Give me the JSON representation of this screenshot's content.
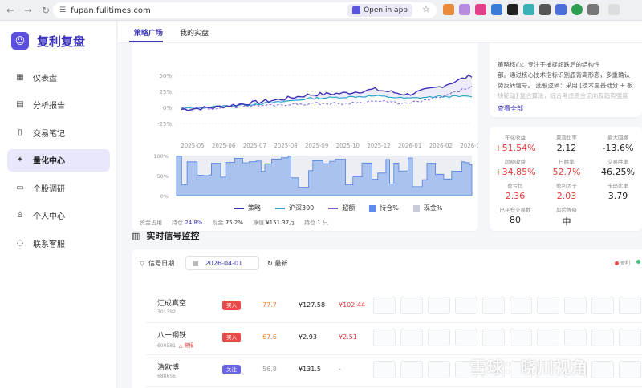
{
  "browser": {
    "url": "fupan.fulitimes.com",
    "open_in_app": "Open in app"
  },
  "sidebar": {
    "app_name": "复利复盘",
    "items": [
      {
        "label": "仪表盘",
        "icon": "grid-icon"
      },
      {
        "label": "分析报告",
        "icon": "document-icon"
      },
      {
        "label": "交易笔记",
        "icon": "notebook-icon"
      },
      {
        "label": "量化中心",
        "icon": "sparkle-icon",
        "active": true
      },
      {
        "label": "个股调研",
        "icon": "file-icon"
      },
      {
        "label": "个人中心",
        "icon": "user-icon"
      },
      {
        "label": "联系客服",
        "icon": "chat-icon"
      }
    ]
  },
  "tabs": {
    "strategy": "策略广场",
    "mine": "我的实盘"
  },
  "info": {
    "line1": "策略核心：专注于捕捉超跌后的结构性",
    "line2": "部。通过核心技术指标识别底背离形态，多重确认",
    "line3": "势反转信号。 选股逻辑：采用 [技术面基础分 + 板",
    "line4": "块轮动] 复合算法，综合考虑资金流向及趋势强度",
    "view_all": "查看全部"
  },
  "metrics": [
    {
      "label": "年化收益",
      "value": "+51.54%",
      "red": true
    },
    {
      "label": "夏普比率",
      "value": "2.12"
    },
    {
      "label": "最大回撤",
      "value": "-13.6%"
    },
    {
      "label": "超额收益",
      "value": "+34.85%",
      "red": true
    },
    {
      "label": "日胜率",
      "value": "52.7%",
      "red": true
    },
    {
      "label": "交易胜率",
      "value": "46.25%"
    },
    {
      "label": "盈亏比",
      "value": "2.36",
      "red": true
    },
    {
      "label": "盈利因子",
      "value": "2.03",
      "red": true
    },
    {
      "label": "卡玛比率",
      "value": "3.79"
    },
    {
      "label": "已平仓交易数",
      "value": "80"
    },
    {
      "label": "风险等级",
      "value": "中"
    }
  ],
  "chart_data": {
    "type": "line",
    "x": [
      "2025-05",
      "2025-06",
      "2025-07",
      "2025-08",
      "2025-09",
      "2025-10",
      "2025-12",
      "2026-01",
      "2026-02",
      "2026-04"
    ],
    "y_ticks": [
      "50%",
      "25%",
      "0%",
      "-25%"
    ],
    "ylim": [
      -25,
      75
    ],
    "series": [
      {
        "name": "策略",
        "color": "#3b2fb8",
        "values": [
          -3,
          0,
          6,
          12,
          20,
          22,
          28,
          20,
          32,
          50
        ]
      },
      {
        "name": "沪深300",
        "color": "#2aa7c9",
        "values": [
          -2,
          1,
          4,
          8,
          14,
          16,
          18,
          14,
          17,
          17
        ]
      },
      {
        "name": "超额",
        "color": "#7a5fd6",
        "values": [
          -1,
          -1,
          2,
          4,
          6,
          6,
          10,
          6,
          15,
          33
        ]
      }
    ],
    "position_chart": {
      "y_ticks": [
        "100%",
        "50%",
        "0%"
      ],
      "series": [
        {
          "name": "持仓%",
          "color": "#5b8ee8"
        },
        {
          "name": "现金%",
          "color": "#c9ccd6"
        }
      ]
    }
  },
  "stats": {
    "capital_label": "资金占用",
    "position_label": "持仓",
    "position_value": "24.8%",
    "cash_label": "现金",
    "cash_value": "75.2%",
    "nav_label": "净值",
    "nav_value": "¥151.37万",
    "holdings_label": "持仓",
    "holdings_value": "1",
    "holdings_unit": "只"
  },
  "signals": {
    "title": "实时信号监控",
    "date_label": "信号日期",
    "date_value": "2026-04-01",
    "refresh": "最新",
    "legend_profit": "盈利",
    "rows": [
      {
        "name": "汇成真空",
        "code": "301392",
        "hot": "",
        "tag": "买入",
        "tag_type": "buy",
        "score": "77.7",
        "score_color": "#e8842b",
        "price": "¥127.58",
        "target": "¥102.44"
      },
      {
        "name": "八一钢铁",
        "code": "600581",
        "hot": "△ 警报",
        "tag": "买入",
        "tag_type": "buy",
        "score": "67.6",
        "score_color": "#e8842b",
        "price": "¥2.93",
        "target": "¥2.51"
      },
      {
        "name": "浩欧博",
        "code": "688656",
        "hot": "",
        "tag": "关注",
        "tag_type": "watch",
        "score": "56.8",
        "score_color": "#999999",
        "price": "¥131.5",
        "target": "-"
      }
    ]
  },
  "watermark": "雪球：晓川视角"
}
